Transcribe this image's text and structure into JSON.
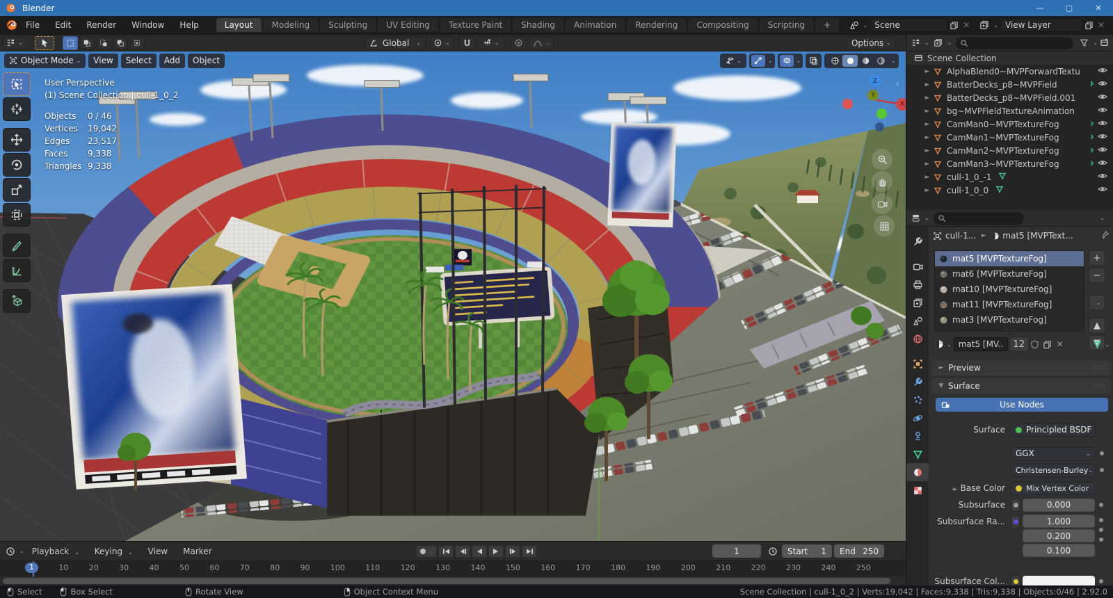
{
  "titlebar": {
    "title": "Blender"
  },
  "menubar": {
    "menus": [
      "File",
      "Edit",
      "Render",
      "Window",
      "Help"
    ],
    "tabs": [
      "Layout",
      "Modeling",
      "Sculpting",
      "UV Editing",
      "Texture Paint",
      "Shading",
      "Animation",
      "Rendering",
      "Compositing",
      "Scripting"
    ],
    "add_tab": "+",
    "scene": {
      "value": "Scene"
    },
    "view_layer": {
      "value": "View Layer"
    }
  },
  "tool_settings": {
    "orientation": "Global",
    "options": "Options"
  },
  "vp_header": {
    "mode": "Object Mode",
    "menus": [
      "View",
      "Select",
      "Add",
      "Object"
    ]
  },
  "viewport": {
    "projection": "User Perspective",
    "context": "(1) Scene Collection | cull-1_0_2",
    "stats": [
      {
        "label": "Objects",
        "value": "0 / 46"
      },
      {
        "label": "Vertices",
        "value": "19,042"
      },
      {
        "label": "Edges",
        "value": "23,517"
      },
      {
        "label": "Faces",
        "value": "9,338"
      },
      {
        "label": "Triangles",
        "value": "9,338"
      }
    ],
    "axis": {
      "x": "X",
      "y": "Y",
      "z": "Z"
    }
  },
  "outliner": {
    "root": "Scene Collection",
    "items": [
      "AlphaBlend0~MVPForwardTextu",
      "BatterDecks_p8~MVPField",
      "BatterDecks_p8~MVPField.001",
      "bg~MVPFieldTextureAnimation",
      "CamMan0~MVPTextureFog",
      "CamMan1~MVPTextureFog",
      "CamMan2~MVPTextureFog",
      "CamMan3~MVPTextureFog",
      "cull-1_0_-1",
      "cull-1_0_0"
    ]
  },
  "properties": {
    "breadcrumb": {
      "object": "cull-1...",
      "material": "mat5 [MVPText..."
    },
    "slots": [
      "mat5 [MVPTextureFog]",
      "mat6 [MVPTextureFog]",
      "mat10 [MVPTextureFog]",
      "mat11 [MVPTextureFog]",
      "mat3 [MVPTextureFog]"
    ],
    "selector": {
      "name": "mat5 [MV...",
      "users": "12"
    },
    "preview_panel": "Preview",
    "surface_panel": "Surface",
    "use_nodes": "Use Nodes",
    "surface_label": "Surface",
    "surface_value": "Principled BSDF",
    "distribution": "GGX",
    "subsurface_method": "Christensen-Burley",
    "base_color_label": "Base Color",
    "base_color_value": "Mix Vertex Color",
    "subsurface_label": "Subsurface",
    "subsurface_value": "0.000",
    "radius_label": "Subsurface Ra...",
    "radius_values": [
      "1.000",
      "0.200",
      "0.100"
    ],
    "sss_color_label": "Subsurface Col..."
  },
  "timeline": {
    "menus": [
      "Playback",
      "Keying",
      "View",
      "Marker"
    ],
    "ticks": [
      "1",
      "10",
      "20",
      "30",
      "40",
      "50",
      "60",
      "70",
      "80",
      "90",
      "100",
      "110",
      "120",
      "130",
      "140",
      "150",
      "160",
      "170",
      "180",
      "190",
      "200",
      "210",
      "220",
      "230",
      "240",
      "250"
    ],
    "current": "1",
    "start_label": "Start",
    "start": "1",
    "end_label": "End",
    "end": "250"
  },
  "status": {
    "hints": [
      "Select",
      "Box Select",
      "Rotate View",
      "Object Context Menu"
    ],
    "stats": "Scene Collection | cull-1_0_2 | Verts:19,042 | Faces:9,338 | Tris:9,338 | Objects:0/46 | 2.92.0"
  },
  "colors": {
    "accent": "#4f76b8",
    "titlebar": "#2f6fb4",
    "use_nodes_blue": "#4772b3",
    "seat_red": "#bc3a33",
    "seat_purple": "#4c4e90",
    "seat_yellow": "#b0a052",
    "field_green": "#56893a",
    "dirt": "#c8a565",
    "selected_slot": "#5d6d91"
  }
}
